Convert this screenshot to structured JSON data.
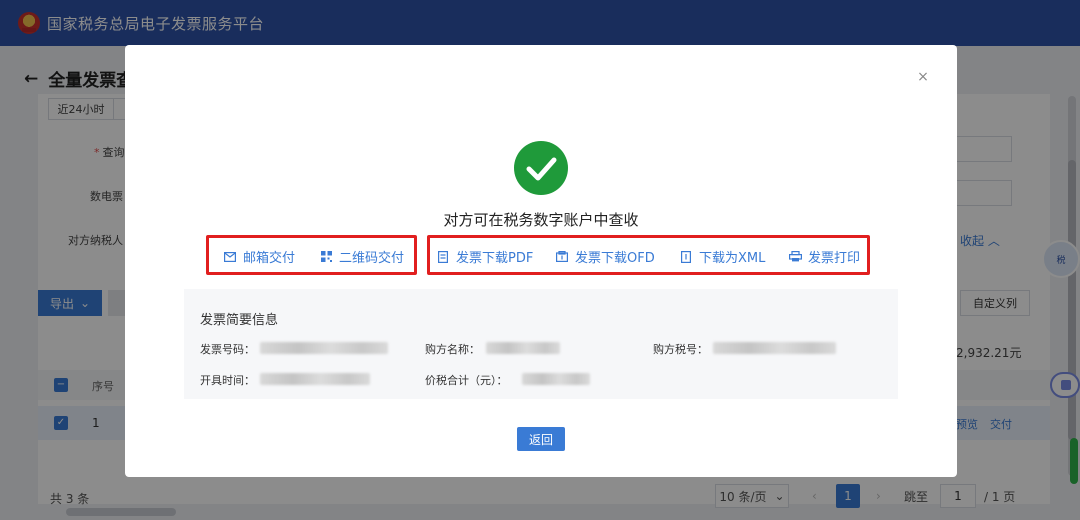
{
  "header": {
    "title": "国家税务总局电子发票服务平台"
  },
  "page": {
    "breadcrumb": "全量发票查",
    "tab_label": "近24小时",
    "field_query_label": "查询",
    "field_invoice_no_label": "数电票",
    "field_counterparty_label": "对方纳税人",
    "collapse_label": "收起",
    "export_label": "导出",
    "custom_columns_label": "自定义列",
    "amount_text": "2,932.21元",
    "seq_header": "序号",
    "row_seq": "1",
    "row_action_preview": "预览",
    "row_action_deliver": "交付",
    "total_text": "共 3 条",
    "page_size": "10 条/页",
    "current_page": "1",
    "jump_label": "跳至",
    "jump_value": "1",
    "total_pages": "/ 1 页"
  },
  "modal": {
    "close_icon": "×",
    "message": "对方可在税务数字账户中查收",
    "deliver_actions": [
      {
        "label": "邮箱交付",
        "icon": "mail-icon"
      },
      {
        "label": "二维码交付",
        "icon": "qrcode-icon"
      }
    ],
    "download_actions": [
      {
        "label": "发票下载PDF",
        "icon": "pdf-icon"
      },
      {
        "label": "发票下载OFD",
        "icon": "ofd-icon"
      },
      {
        "label": "下载为XML",
        "icon": "xml-icon"
      },
      {
        "label": "发票打印",
        "icon": "printer-icon"
      }
    ],
    "summary": {
      "title": "发票简要信息",
      "invoice_no_label": "发票号码：",
      "buyer_name_label": "购方名称：",
      "buyer_tax_no_label": "购方税号：",
      "issue_time_label": "开具时间：",
      "total_label": "价税合计（元）："
    },
    "return_label": "返回"
  },
  "colors": {
    "header_bg": "#2f53a8",
    "accent": "#3a7bd5",
    "success": "#1f9a3a",
    "highlight_box": "#e11f1f"
  }
}
